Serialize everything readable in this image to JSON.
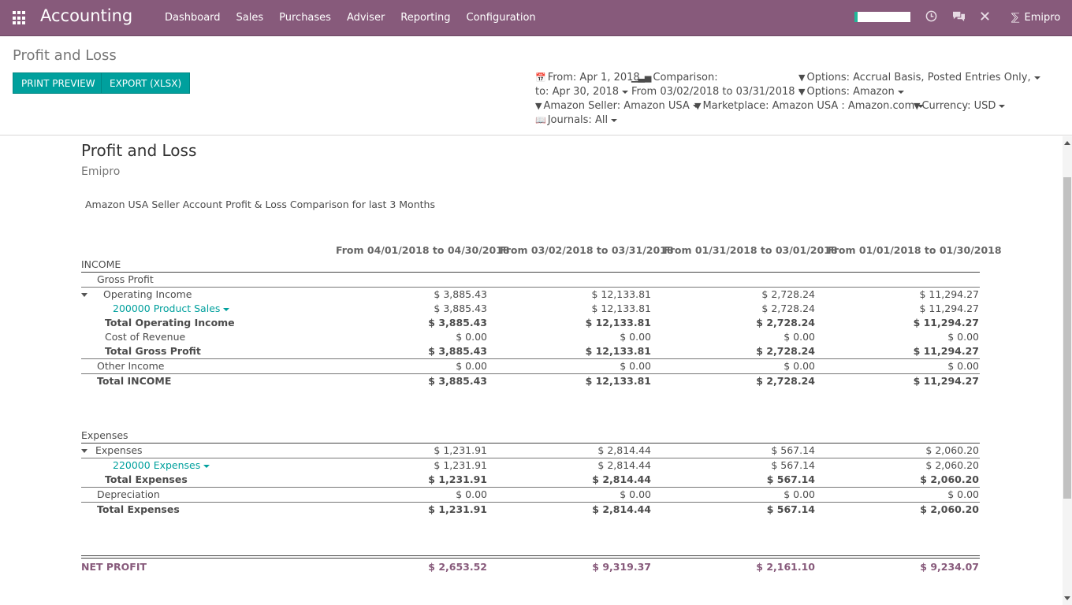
{
  "navbar": {
    "brand": "Accounting",
    "menu": [
      "Dashboard",
      "Sales",
      "Purchases",
      "Adviser",
      "Reporting",
      "Configuration"
    ],
    "user": "Emipro",
    "icons": [
      "apps-icon",
      "clock-icon",
      "chat-icon",
      "tools-icon"
    ]
  },
  "control_panel": {
    "breadcrumb": "Profit and Loss",
    "buttons": {
      "print_preview": "PRINT PREVIEW",
      "export": "EXPORT (XLSX)"
    },
    "filters": {
      "date_from": "From: Apr 1, 2018",
      "date_to": "to: Apr 30, 2018",
      "comparison": "Comparison:",
      "comparison_range": "From 03/02/2018 to 03/31/2018",
      "options_accrual": "Options: Accrual Basis, Posted Entries Only,",
      "options_amazon": "Options: Amazon",
      "amazon_seller": "Amazon Seller: Amazon USA",
      "marketplace": "Marketplace: Amazon USA : Amazon.com",
      "currency": "Currency: USD",
      "journals": "Journals: All"
    }
  },
  "report": {
    "title": "Profit and Loss",
    "company": "Emipro",
    "description": "Amazon USA Seller Account Profit & Loss Comparison for last 3 Months",
    "columns": [
      "From 04/01/2018 to 04/30/2018",
      "From 03/02/2018 to 03/31/2018",
      "From 01/31/2018 to 03/01/2018",
      "From 01/01/2018 to 01/30/2018"
    ],
    "income_header": "INCOME",
    "income_rows": [
      {
        "label": "Gross Profit",
        "values": [
          "",
          "",
          "",
          ""
        ]
      },
      {
        "label": "Operating Income",
        "values": [
          "$ 3,885.43",
          "$ 12,133.81",
          "$ 2,728.24",
          "$ 11,294.27"
        ]
      },
      {
        "label": "200000 Product Sales",
        "values": [
          "$ 3,885.43",
          "$ 12,133.81",
          "$ 2,728.24",
          "$ 11,294.27"
        ]
      },
      {
        "label": "Total Operating Income",
        "values": [
          "$ 3,885.43",
          "$ 12,133.81",
          "$ 2,728.24",
          "$ 11,294.27"
        ]
      },
      {
        "label": "Cost of Revenue",
        "values": [
          "$ 0.00",
          "$ 0.00",
          "$ 0.00",
          "$ 0.00"
        ]
      },
      {
        "label": "Total Gross Profit",
        "values": [
          "$ 3,885.43",
          "$ 12,133.81",
          "$ 2,728.24",
          "$ 11,294.27"
        ]
      },
      {
        "label": "Other Income",
        "values": [
          "$ 0.00",
          "$ 0.00",
          "$ 0.00",
          "$ 0.00"
        ]
      },
      {
        "label": "Total INCOME",
        "values": [
          "$ 3,885.43",
          "$ 12,133.81",
          "$ 2,728.24",
          "$ 11,294.27"
        ]
      }
    ],
    "expenses_header": "Expenses",
    "expense_rows": [
      {
        "label": "Expenses",
        "values": [
          "$ 1,231.91",
          "$ 2,814.44",
          "$ 567.14",
          "$ 2,060.20"
        ]
      },
      {
        "label": "220000 Expenses",
        "values": [
          "$ 1,231.91",
          "$ 2,814.44",
          "$ 567.14",
          "$ 2,060.20"
        ]
      },
      {
        "label": "Total Expenses",
        "values": [
          "$ 1,231.91",
          "$ 2,814.44",
          "$ 567.14",
          "$ 2,060.20"
        ]
      },
      {
        "label": "Depreciation",
        "values": [
          "$ 0.00",
          "$ 0.00",
          "$ 0.00",
          "$ 0.00"
        ]
      },
      {
        "label": "Total Expenses",
        "values": [
          "$ 1,231.91",
          "$ 2,814.44",
          "$ 567.14",
          "$ 2,060.20"
        ]
      }
    ],
    "net_profit": {
      "label": "NET PROFIT",
      "values": [
        "$ 2,653.52",
        "$ 9,319.37",
        "$ 2,161.10",
        "$ 9,234.07"
      ]
    }
  },
  "colors": {
    "navbar": "#875a7b",
    "button": "#00a09d",
    "link": "#00a09d",
    "net_profit": "#875a7b"
  }
}
